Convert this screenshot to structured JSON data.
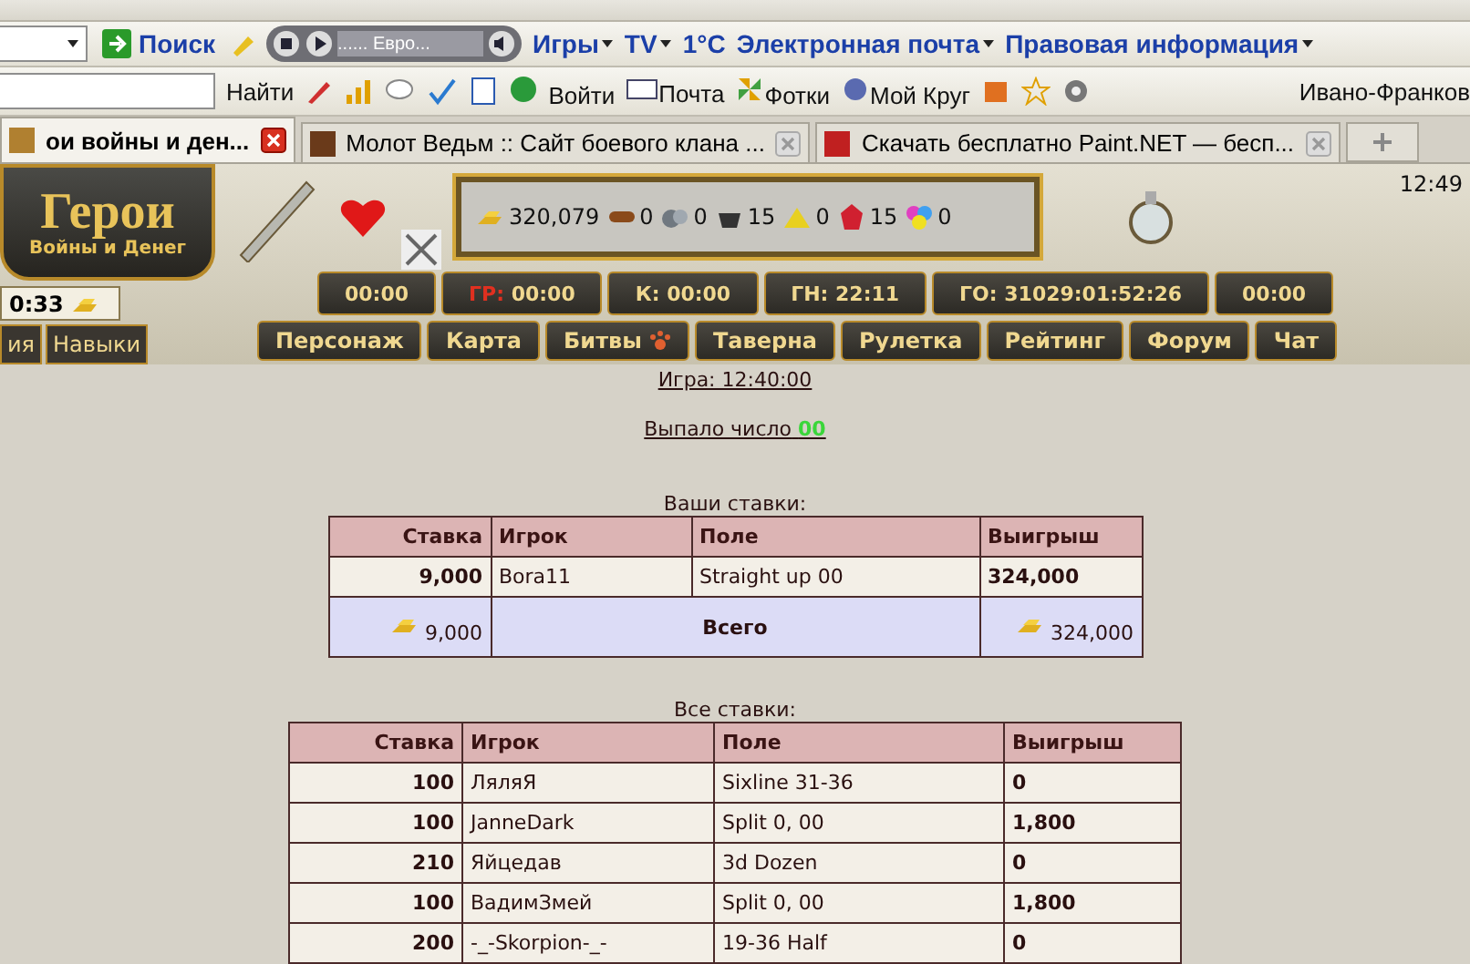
{
  "browser": {
    "toolbar1": {
      "search_button": "Поиск",
      "player_track": "......   Евро...",
      "links": [
        {
          "label": "Игры",
          "menu": true
        },
        {
          "label": "TV",
          "menu": true
        },
        {
          "label": "1°C",
          "menu": false
        },
        {
          "label": "Электронная почта",
          "menu": true
        },
        {
          "label": "Правовая информация",
          "menu": true
        }
      ]
    },
    "toolbar2": {
      "find_label": "Найти",
      "login": "Войти",
      "mail": "Почта",
      "photos": "Фотки",
      "circle": "Мой Круг",
      "location": "Ивано-Франков"
    },
    "tabs": [
      {
        "title": "ои войны и ден...",
        "selected": true
      },
      {
        "title": "Молот Ведьм :: Сайт боевого клана ...",
        "selected": false
      },
      {
        "title": "Скачать бесплатно Paint.NET — бесп...",
        "selected": false
      }
    ]
  },
  "game": {
    "logo_title": "Герои",
    "logo_subtitle": "Войны и Денег",
    "clock": "12:49",
    "resources": [
      {
        "kind": "gold",
        "amount": "320,079"
      },
      {
        "kind": "wood",
        "amount": "0"
      },
      {
        "kind": "ore",
        "amount": "0"
      },
      {
        "kind": "mercury",
        "amount": "15"
      },
      {
        "kind": "sulfur",
        "amount": "0"
      },
      {
        "kind": "crystal",
        "amount": "15"
      },
      {
        "kind": "gems",
        "amount": "0"
      }
    ],
    "side_timer": "0:33",
    "timers": [
      {
        "time": "00:00"
      },
      {
        "prefix": "ГР:",
        "time": " 00:00",
        "alert": true
      },
      {
        "prefix": "К:",
        "time": " 00:00",
        "alert": false
      },
      {
        "prefix": "ГН:",
        "time": " 22:11",
        "alert": false
      },
      {
        "prefix": "ГО:",
        "time": " 31029:01:52:26",
        "alert": false
      },
      {
        "time": "00:00"
      }
    ],
    "side_tabs": [
      "ия",
      "Навыки"
    ],
    "nav": [
      {
        "label": "Персонаж",
        "kind": "plain"
      },
      {
        "label": "Карта",
        "kind": "plain"
      },
      {
        "label": "Битвы",
        "kind": "paw"
      },
      {
        "label": "Таверна",
        "kind": "plain"
      },
      {
        "label": "Рулетка",
        "kind": "plain"
      },
      {
        "label": "Рейтинг",
        "kind": "plain"
      },
      {
        "label": "Форум",
        "kind": "plain"
      },
      {
        "label": "Чат",
        "kind": "plain"
      }
    ]
  },
  "roulette": {
    "game_time": "Игра: 12:40:00",
    "result_label": "Выпало число",
    "result_number": "00",
    "your_bets": {
      "caption": "Ваши ставки:",
      "columns": [
        "Ставка",
        "Игрок",
        "Поле",
        "Выигрыш"
      ],
      "rows": [
        {
          "stake": "9,000",
          "player": "Bora11",
          "field": "Straight up 00",
          "win": "324,000"
        }
      ],
      "total": {
        "stake": "9,000",
        "label": "Всего",
        "win": "324,000"
      }
    },
    "all_bets": {
      "caption": "Все ставки:",
      "columns": [
        "Ставка",
        "Игрок",
        "Поле",
        "Выигрыш"
      ],
      "rows": [
        {
          "stake": "100",
          "player": "ЛяляЯ",
          "field": "Sixline 31-36",
          "win": "0"
        },
        {
          "stake": "100",
          "player": "JanneDark",
          "field": "Split 0, 00",
          "win": "1,800"
        },
        {
          "stake": "210",
          "player": "Яйцедав",
          "field": "3d Dozen",
          "win": "0"
        },
        {
          "stake": "100",
          "player": "ВадимЗмей",
          "field": "Split 0, 00",
          "win": "1,800"
        },
        {
          "stake": "200",
          "player": "-_-Skorpion-_-",
          "field": "19-36 Half",
          "win": "0"
        }
      ]
    }
  }
}
